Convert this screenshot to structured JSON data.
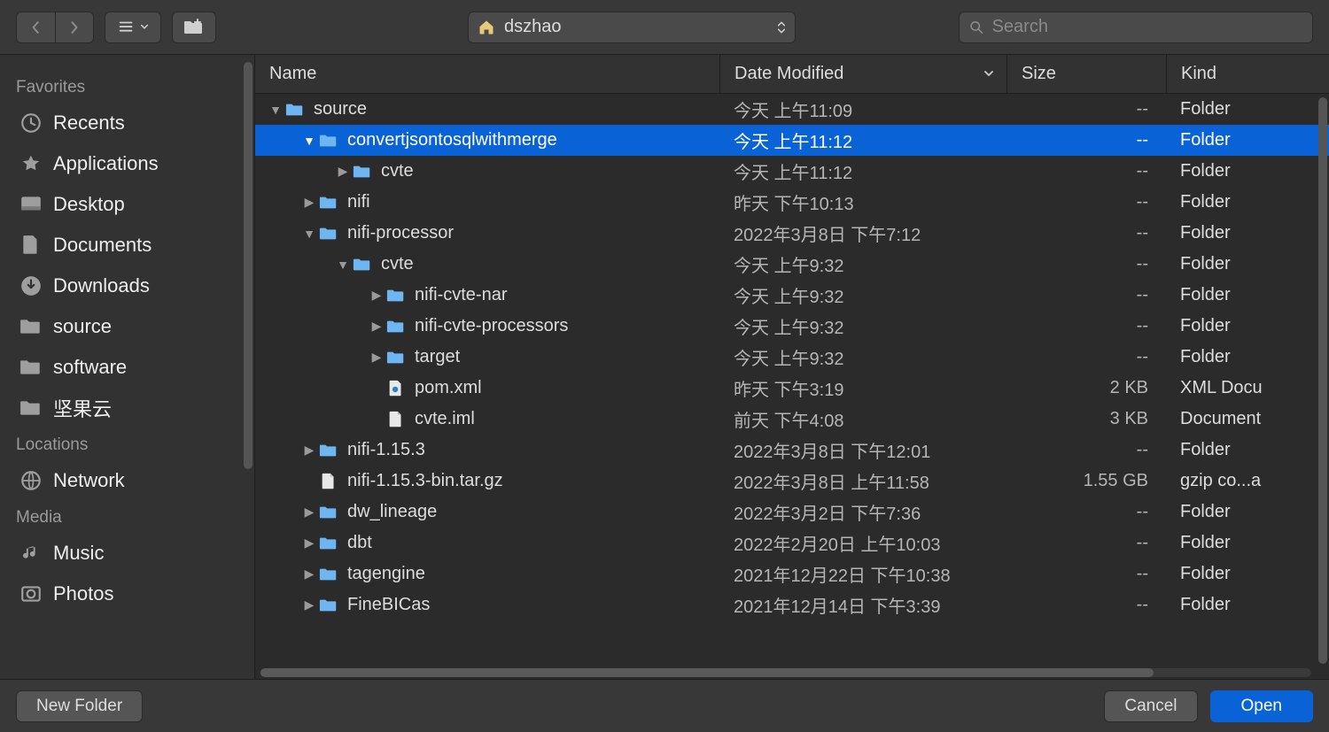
{
  "toolbar": {
    "path_label": "dszhao",
    "search_placeholder": "Search"
  },
  "sidebar": {
    "sections": [
      {
        "label": "Favorites",
        "items": [
          {
            "icon": "recents",
            "label": "Recents"
          },
          {
            "icon": "apps",
            "label": "Applications"
          },
          {
            "icon": "desktop",
            "label": "Desktop"
          },
          {
            "icon": "docs",
            "label": "Documents"
          },
          {
            "icon": "downloads",
            "label": "Downloads"
          },
          {
            "icon": "folder",
            "label": "source"
          },
          {
            "icon": "folder",
            "label": "software"
          },
          {
            "icon": "folder",
            "label": "坚果云"
          }
        ]
      },
      {
        "label": "Locations",
        "items": [
          {
            "icon": "network",
            "label": "Network"
          }
        ]
      },
      {
        "label": "Media",
        "items": [
          {
            "icon": "music",
            "label": "Music"
          },
          {
            "icon": "photos",
            "label": "Photos"
          }
        ]
      }
    ]
  },
  "columns": {
    "name": "Name",
    "date": "Date Modified",
    "size": "Size",
    "kind": "Kind"
  },
  "rows": [
    {
      "indent": 0,
      "tri": "down",
      "icon": "folder",
      "name": "source",
      "date": "今天 上午11:09",
      "size": "--",
      "kind": "Folder",
      "sel": false
    },
    {
      "indent": 1,
      "tri": "down",
      "icon": "folder",
      "name": "convertjsontosqlwithmerge",
      "date": "今天 上午11:12",
      "size": "--",
      "kind": "Folder",
      "sel": true
    },
    {
      "indent": 2,
      "tri": "right",
      "icon": "folder",
      "name": "cvte",
      "date": "今天 上午11:12",
      "size": "--",
      "kind": "Folder",
      "sel": false
    },
    {
      "indent": 1,
      "tri": "right",
      "icon": "folder",
      "name": "nifi",
      "date": "昨天 下午10:13",
      "size": "--",
      "kind": "Folder",
      "sel": false
    },
    {
      "indent": 1,
      "tri": "down",
      "icon": "folder",
      "name": "nifi-processor",
      "date": "2022年3月8日 下午7:12",
      "size": "--",
      "kind": "Folder",
      "sel": false
    },
    {
      "indent": 2,
      "tri": "down",
      "icon": "folder",
      "name": "cvte",
      "date": "今天 上午9:32",
      "size": "--",
      "kind": "Folder",
      "sel": false
    },
    {
      "indent": 3,
      "tri": "right",
      "icon": "folder",
      "name": "nifi-cvte-nar",
      "date": "今天 上午9:32",
      "size": "--",
      "kind": "Folder",
      "sel": false
    },
    {
      "indent": 3,
      "tri": "right",
      "icon": "folder",
      "name": "nifi-cvte-processors",
      "date": "今天 上午9:32",
      "size": "--",
      "kind": "Folder",
      "sel": false
    },
    {
      "indent": 3,
      "tri": "right",
      "icon": "folder",
      "name": "target",
      "date": "今天 上午9:32",
      "size": "--",
      "kind": "Folder",
      "sel": false
    },
    {
      "indent": 3,
      "tri": "none",
      "icon": "xml",
      "name": "pom.xml",
      "date": "昨天 下午3:19",
      "size": "2 KB",
      "kind": "XML Docu",
      "sel": false
    },
    {
      "indent": 3,
      "tri": "none",
      "icon": "file",
      "name": "cvte.iml",
      "date": "前天 下午4:08",
      "size": "3 KB",
      "kind": "Document",
      "sel": false
    },
    {
      "indent": 1,
      "tri": "right",
      "icon": "folder",
      "name": "nifi-1.15.3",
      "date": "2022年3月8日 下午12:01",
      "size": "--",
      "kind": "Folder",
      "sel": false
    },
    {
      "indent": 1,
      "tri": "none",
      "icon": "file",
      "name": "nifi-1.15.3-bin.tar.gz",
      "date": "2022年3月8日 上午11:58",
      "size": "1.55 GB",
      "kind": "gzip co...a",
      "sel": false
    },
    {
      "indent": 1,
      "tri": "right",
      "icon": "folder",
      "name": "dw_lineage",
      "date": "2022年3月2日 下午7:36",
      "size": "--",
      "kind": "Folder",
      "sel": false
    },
    {
      "indent": 1,
      "tri": "right",
      "icon": "folder",
      "name": "dbt",
      "date": "2022年2月20日 上午10:03",
      "size": "--",
      "kind": "Folder",
      "sel": false
    },
    {
      "indent": 1,
      "tri": "right",
      "icon": "folder",
      "name": "tagengine",
      "date": "2021年12月22日 下午10:38",
      "size": "--",
      "kind": "Folder",
      "sel": false
    },
    {
      "indent": 1,
      "tri": "right",
      "icon": "folder",
      "name": "FineBICas",
      "date": "2021年12月14日 下午3:39",
      "size": "--",
      "kind": "Folder",
      "sel": false
    }
  ],
  "footer": {
    "new_folder": "New Folder",
    "cancel": "Cancel",
    "open": "Open"
  }
}
